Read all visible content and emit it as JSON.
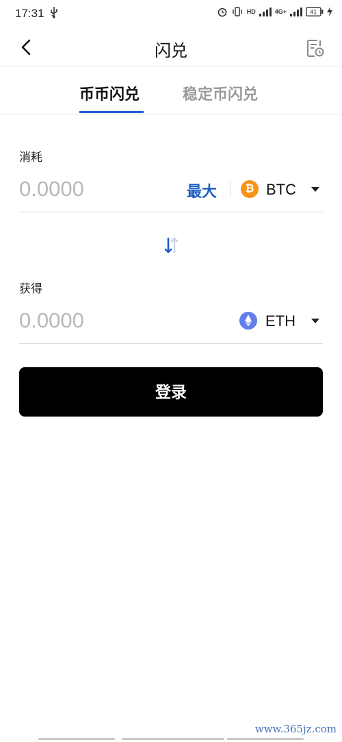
{
  "status_bar": {
    "time": "17:31",
    "network_label": "4G+",
    "hd_label": "HD",
    "battery": "41"
  },
  "header": {
    "title": "闪兑",
    "icons": {
      "back": "chevron-left-icon",
      "history": "history-record-icon"
    }
  },
  "tabs": [
    {
      "label": "币币闪兑",
      "active": true
    },
    {
      "label": "稳定币闪兑",
      "active": false
    }
  ],
  "consume": {
    "label": "消耗",
    "amount_placeholder": "0.0000",
    "max_label": "最大",
    "coin": "BTC",
    "coin_symbol": "₿",
    "coin_color": "#f7931a"
  },
  "receive": {
    "label": "获得",
    "amount_placeholder": "0.0000",
    "coin": "ETH",
    "coin_color": "#627eea"
  },
  "actions": {
    "login_label": "登录"
  },
  "watermark": "www.365jz.com",
  "colors": {
    "accent": "#1f63d6",
    "primary_button": "#000000"
  }
}
